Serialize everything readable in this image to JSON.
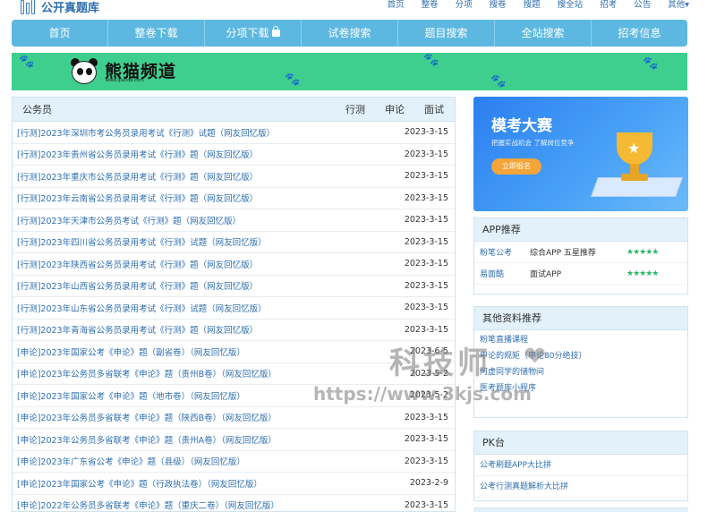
{
  "site": {
    "name": "公开真题库"
  },
  "top_links": [
    "首页",
    "整卷",
    "分项",
    "搜卷",
    "搜题",
    "搜全站",
    "招考",
    "公告",
    "其他▾"
  ],
  "nav": [
    "首页",
    "整卷下载",
    "分项下载",
    "试卷搜索",
    "题目搜索",
    "全站搜索",
    "招考信息"
  ],
  "banner": {
    "brand": "熊猫频道",
    "url": "www.ipanda.com"
  },
  "list": {
    "title": "公务员",
    "tabs": [
      "行测",
      "申论",
      "面试"
    ],
    "rows": [
      {
        "title": "[行测]2023年深圳市考公务员录用考试《行测》试题（网友回忆版）",
        "date": "2023-3-15"
      },
      {
        "title": "[行测]2023年贵州省公务员录用考试《行测》题（网友回忆版）",
        "date": "2023-3-15"
      },
      {
        "title": "[行测]2023年重庆市公务员录用考试《行测》题（网友回忆版）",
        "date": "2023-3-15"
      },
      {
        "title": "[行测]2023年云南省公务员录用考试《行测》题（网友回忆版）",
        "date": "2023-3-15"
      },
      {
        "title": "[行测]2023年天津市公务员考试《行测》题（网友回忆版）",
        "date": "2023-3-15"
      },
      {
        "title": "[行测]2023年四川省公务员录用考试《行测》试题（网友回忆版）",
        "date": "2023-3-15"
      },
      {
        "title": "[行测]2023年陕西省公务员录用考试《行测》题（网友回忆版）",
        "date": "2023-3-15"
      },
      {
        "title": "[行测]2023年山西省公务员录用考试《行测》题（网友回忆版）",
        "date": "2023-3-15"
      },
      {
        "title": "[行测]2023年山东省公务员录用考试《行测》试题（网友回忆版）",
        "date": "2023-3-15"
      },
      {
        "title": "[行测]2023年青海省公务员录用考试《行测》题（网友回忆版）",
        "date": "2023-3-15"
      },
      {
        "title": "[申论]2023年国家公考《申论》题（副省卷）（网友回忆版）",
        "date": "2023-6-5"
      },
      {
        "title": "[申论]2023年公务员多省联考《申论》题（贵州B卷）（网友回忆版）",
        "date": "2023-5-2"
      },
      {
        "title": "[申论]2023年国家公考《申论》题（地市卷）（网友回忆版）",
        "date": "2023-5-2"
      },
      {
        "title": "[申论]2023年公务员多省联考《申论》题（陕西B卷）（网友回忆版）",
        "date": "2023-3-15"
      },
      {
        "title": "[申论]2023年公务员多省联考《申论》题（贵州A卷）（网友回忆版）",
        "date": "2023-3-15"
      },
      {
        "title": "[申论]2023年广东省公考《申论》题（县级）（网友回忆版）",
        "date": "2023-3-15"
      },
      {
        "title": "[申论]2023年国家公考《申论》题（行政执法卷）（网友回忆版）",
        "date": "2023-2-9"
      },
      {
        "title": "[申论]2022年公务员多省联考《申论》题（重庆二卷）（网友回忆版）",
        "date": "2023-3-15"
      }
    ]
  },
  "promo": {
    "title": "模考大赛",
    "subtitle": "把握实战机会  了解岗位竞争",
    "button": "立即报名"
  },
  "apps": {
    "title": "APP推荐",
    "items": [
      {
        "name": "粉笔公考",
        "desc": "综合APP 五星推荐",
        "stars": "★★★★★"
      },
      {
        "name": "易面酷",
        "desc": "面试APP",
        "stars": "★★★★★"
      }
    ]
  },
  "resources": {
    "title": "其他资料推荐",
    "items": [
      "粉笔直播课程",
      "申论的规矩（申论80分绝技）",
      "阿虚同学的储物间",
      "医考题库小程序"
    ]
  },
  "pk": {
    "title": "PK台",
    "items": [
      "公考刷题APP大比拼",
      "公考行测真题解析大比拼"
    ]
  },
  "watermark": {
    "main": "科技师",
    "url": "https://www.3kjs.com"
  }
}
